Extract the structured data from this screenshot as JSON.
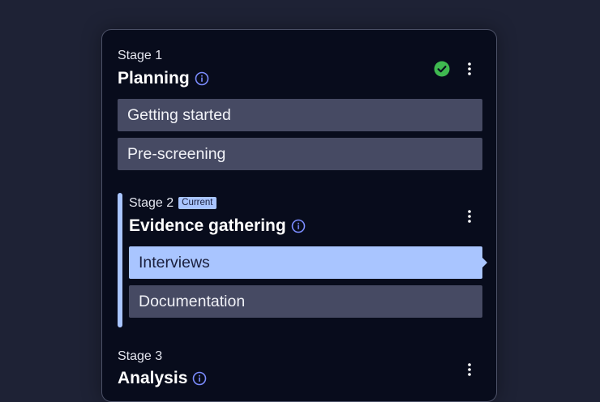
{
  "stages": [
    {
      "label": "Stage 1",
      "title": "Planning",
      "status": "complete",
      "status_color": "#3fb950",
      "steps": [
        "Getting started",
        "Pre-screening"
      ]
    },
    {
      "label": "Stage 2",
      "badge": "Current",
      "title": "Evidence gathering",
      "steps": [
        "Interviews",
        "Documentation"
      ],
      "active_step": "Interviews"
    },
    {
      "label": "Stage 3",
      "title": "Analysis"
    }
  ],
  "colors": {
    "accent": "#a9c5ff",
    "info_icon": "#7b8cff",
    "step_bg": "#464a63",
    "card_bg": "#080c1c"
  },
  "icons": {
    "info": "info-icon",
    "complete": "check-circle-icon",
    "menu": "kebab-menu-icon"
  }
}
